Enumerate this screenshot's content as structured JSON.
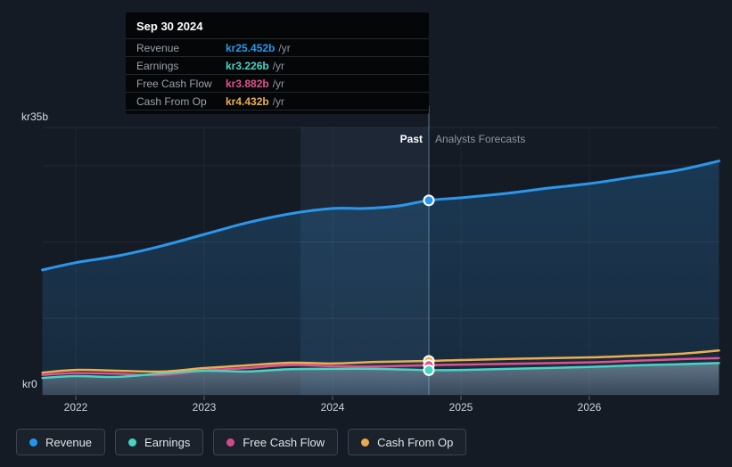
{
  "chart": {
    "y_axis": {
      "top_label": "kr35b",
      "bottom_label": "kr0"
    },
    "annotations": {
      "past_label": "Past",
      "forecast_label": "Analysts Forecasts"
    }
  },
  "tooltip": {
    "title": "Sep 30 2024",
    "rows": [
      {
        "label": "Revenue",
        "value": "kr25.452b",
        "suffix": "/yr",
        "color": "#2b97ec"
      },
      {
        "label": "Earnings",
        "value": "kr3.226b",
        "suffix": "/yr",
        "color": "#45d5c2"
      },
      {
        "label": "Free Cash Flow",
        "value": "kr3.882b",
        "suffix": "/yr",
        "color": "#e2508f"
      },
      {
        "label": "Cash From Op",
        "value": "kr4.432b",
        "suffix": "/yr",
        "color": "#ecae4e"
      }
    ]
  },
  "legend": [
    {
      "id": "revenue",
      "label": "Revenue",
      "color": "#2196ef"
    },
    {
      "id": "earnings",
      "label": "Earnings",
      "color": "#45d5c2"
    },
    {
      "id": "free-cash-flow",
      "label": "Free Cash Flow",
      "color": "#d24b8c"
    },
    {
      "id": "cash-from-op",
      "label": "Cash From Op",
      "color": "#e9ab4d"
    }
  ],
  "chart_data": {
    "type": "line",
    "title": "Past and forecast financials (kr billions per year)",
    "unit": "kr billions /yr",
    "ylim": [
      0,
      35
    ],
    "gridline_values": [
      35,
      30,
      20,
      10,
      0
    ],
    "x_domain": [
      2021.74,
      2027.01
    ],
    "x_ticks": [
      2022,
      2023,
      2024,
      2025,
      2026
    ],
    "divider_x": 2024.75,
    "highlight_band": [
      2023.75,
      2024.75
    ],
    "marker_x": 2024.75,
    "legend_position": "bottom",
    "series": [
      {
        "name": "Free Cash Flow",
        "color": "#e2508f",
        "width": 2.5,
        "marker_value": 3.882,
        "points": [
          [
            2021.74,
            2.6
          ],
          [
            2022.0,
            2.85
          ],
          [
            2022.33,
            2.75
          ],
          [
            2022.67,
            2.6
          ],
          [
            2023.0,
            3.2
          ],
          [
            2023.33,
            3.5
          ],
          [
            2023.67,
            3.9
          ],
          [
            2024.0,
            3.75
          ],
          [
            2024.33,
            3.7
          ],
          [
            2024.75,
            3.882
          ],
          [
            2025.0,
            3.95
          ],
          [
            2025.37,
            4.05
          ],
          [
            2026.0,
            4.25
          ],
          [
            2026.34,
            4.45
          ],
          [
            2026.69,
            4.65
          ],
          [
            2027.01,
            4.8
          ]
        ]
      },
      {
        "name": "Earnings",
        "color": "#45d5c2",
        "width": 2.5,
        "marker_value": 3.226,
        "area": "gray",
        "points": [
          [
            2021.74,
            2.2
          ],
          [
            2022.0,
            2.45
          ],
          [
            2022.33,
            2.35
          ],
          [
            2022.67,
            2.8
          ],
          [
            2023.0,
            3.15
          ],
          [
            2023.33,
            3.05
          ],
          [
            2023.67,
            3.35
          ],
          [
            2024.0,
            3.4
          ],
          [
            2024.33,
            3.4
          ],
          [
            2024.75,
            3.226
          ],
          [
            2025.0,
            3.25
          ],
          [
            2025.37,
            3.4
          ],
          [
            2026.0,
            3.65
          ],
          [
            2026.34,
            3.85
          ],
          [
            2026.69,
            4.0
          ],
          [
            2027.01,
            4.15
          ]
        ]
      },
      {
        "name": "Cash From Op",
        "color": "#ecae4e",
        "width": 2.5,
        "marker_value": 4.432,
        "points": [
          [
            2021.74,
            2.9
          ],
          [
            2022.0,
            3.25
          ],
          [
            2022.33,
            3.15
          ],
          [
            2022.67,
            3.05
          ],
          [
            2023.0,
            3.5
          ],
          [
            2023.33,
            3.85
          ],
          [
            2023.67,
            4.2
          ],
          [
            2024.0,
            4.1
          ],
          [
            2024.33,
            4.3
          ],
          [
            2024.75,
            4.432
          ],
          [
            2025.0,
            4.55
          ],
          [
            2025.37,
            4.7
          ],
          [
            2026.0,
            4.9
          ],
          [
            2026.34,
            5.1
          ],
          [
            2026.69,
            5.35
          ],
          [
            2027.01,
            5.8
          ]
        ]
      },
      {
        "name": "Revenue",
        "color": "#2b97ec",
        "width": 3,
        "marker_value": 25.452,
        "area": "blue",
        "points": [
          [
            2021.74,
            16.35
          ],
          [
            2022.0,
            17.3
          ],
          [
            2022.33,
            18.2
          ],
          [
            2022.67,
            19.5
          ],
          [
            2023.0,
            21.0
          ],
          [
            2023.33,
            22.5
          ],
          [
            2023.67,
            23.7
          ],
          [
            2024.0,
            24.4
          ],
          [
            2024.25,
            24.4
          ],
          [
            2024.5,
            24.7
          ],
          [
            2024.75,
            25.452
          ],
          [
            2025.0,
            25.8
          ],
          [
            2025.37,
            26.4
          ],
          [
            2025.65,
            27.0
          ],
          [
            2026.0,
            27.65
          ],
          [
            2026.34,
            28.5
          ],
          [
            2026.69,
            29.4
          ],
          [
            2027.01,
            30.6
          ]
        ]
      }
    ]
  }
}
